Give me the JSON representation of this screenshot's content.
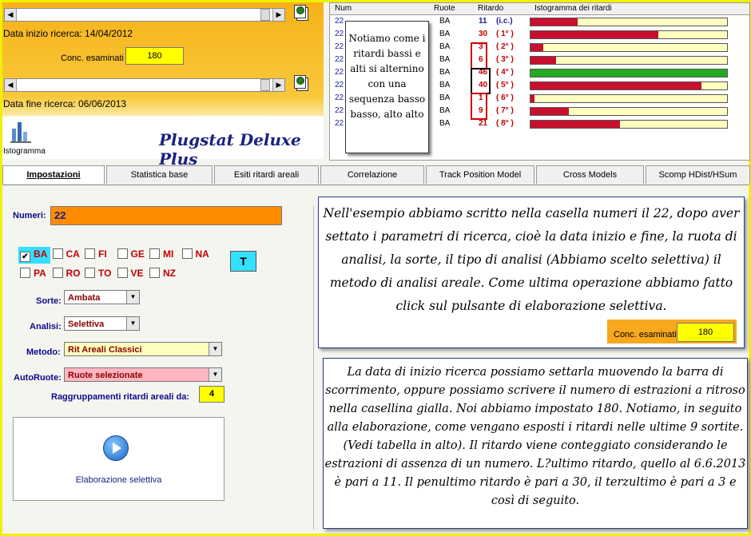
{
  "app": {
    "title": "Plugstat Deluxe Plus",
    "histogram_label": "Istogramma"
  },
  "search": {
    "start_label": "Data inizio ricerca: 14/04/2012",
    "end_label": "Data fine ricerca: 06/06/2013",
    "conc_label": "Conc. esaminati",
    "conc_value": "180"
  },
  "table": {
    "headers": [
      "Num",
      "Ruote",
      "Ritardo",
      "Istogramma dei ritardi"
    ],
    "rows": [
      {
        "num": "22",
        "ruota": "BA",
        "rit": "11",
        "ord": "(i.c.)",
        "val": 11,
        "color": "#c8102e"
      },
      {
        "num": "22",
        "ruota": "BA",
        "rit": "30",
        "ord": "( 1° )",
        "val": 30,
        "color": "#c8102e"
      },
      {
        "num": "22",
        "ruota": "BA",
        "rit": "3",
        "ord": "( 2° )",
        "val": 3,
        "color": "#c8102e"
      },
      {
        "num": "22",
        "ruota": "BA",
        "rit": "6",
        "ord": "( 3° )",
        "val": 6,
        "color": "#c8102e"
      },
      {
        "num": "22",
        "ruota": "BA",
        "rit": "46",
        "ord": "( 4° )",
        "val": 46,
        "color": "#22aa22"
      },
      {
        "num": "22",
        "ruota": "BA",
        "rit": "40",
        "ord": "( 5° )",
        "val": 40,
        "color": "#c8102e"
      },
      {
        "num": "22",
        "ruota": "BA",
        "rit": "1",
        "ord": "( 6° )",
        "val": 1,
        "color": "#c8102e"
      },
      {
        "num": "22",
        "ruota": "BA",
        "rit": "9",
        "ord": "( 7° )",
        "val": 9,
        "color": "#c8102e"
      },
      {
        "num": "22",
        "ruota": "BA",
        "rit": "21",
        "ord": "( 8° )",
        "val": 21,
        "color": "#c8102e"
      }
    ],
    "max_value": 46
  },
  "note": "Notiamo come i ritardi bassi e alti si alternino con una sequenza basso basso, alto alto",
  "tabs": [
    "Impostazioni",
    "Statistica base",
    "Esiti ritardi areali",
    "Correlazione",
    "Track Position Model",
    "Cross Models",
    "Scomp HDist/HSum"
  ],
  "settings": {
    "numeri_label": "Numeri:",
    "numeri_value": "22",
    "ruote_row1": [
      {
        "label": "BA",
        "checked": true
      },
      {
        "label": "CA",
        "checked": false
      },
      {
        "label": "FI",
        "checked": false
      },
      {
        "label": "GE",
        "checked": false
      },
      {
        "label": "MI",
        "checked": false
      },
      {
        "label": "NA",
        "checked": false
      }
    ],
    "ruote_row2": [
      {
        "label": "PA",
        "checked": false
      },
      {
        "label": "RO",
        "checked": false
      },
      {
        "label": "TO",
        "checked": false
      },
      {
        "label": "VE",
        "checked": false
      },
      {
        "label": "NZ",
        "checked": false
      }
    ],
    "t_button": "T",
    "sorte_label": "Sorte:",
    "sorte_value": "Ambata",
    "analisi_label": "Analisi:",
    "analisi_value": "Selettiva",
    "metodo_label": "Metodo:",
    "metodo_value": "Rit Areali Classici",
    "autoruote_label": "AutoRuote:",
    "autoruote_value": "Ruote selezionate",
    "raggruppamenti_label": "Raggruppamenti ritardi areali da:",
    "raggruppamenti_value": "4",
    "elaborazione_label": "Elaborazione selettiva"
  },
  "info1": "Nell'esempio abbiamo scritto nella casella numeri il 22, dopo aver settato i parametri di ricerca, cioè la data inizio e fine, la ruota di analisi, la sorte, il tipo di analisi (Abbiamo scelto selettiva) il metodo di analisi areale. Come ultima operazione abbiamo fatto click sul pulsante di elaborazione selettiva.",
  "info2": "La data di inizio ricerca possiamo settarla muovendo la barra di scorrimento, oppure possiamo scrivere il numero di estrazioni a ritroso nella casellina gialla. Noi abbiamo impostato 180. Notiamo, in seguito alla elaborazione, come vengano esposti i ritardi nelle ultime 9 sortite. (Vedi tabella in alto). Il ritardo viene conteggiato considerando le estrazioni di assenza di un numero. L?ultimo ritardo, quello al 6.6.2013 è pari a 11. Il penultimo ritardo è pari a 30, il terzultimo è pari a 3 e così di seguito.",
  "colors": {
    "accent": "#f7a81c",
    "title": "#1a237e",
    "bar_red": "#c8102e",
    "bar_green": "#22aa22"
  }
}
